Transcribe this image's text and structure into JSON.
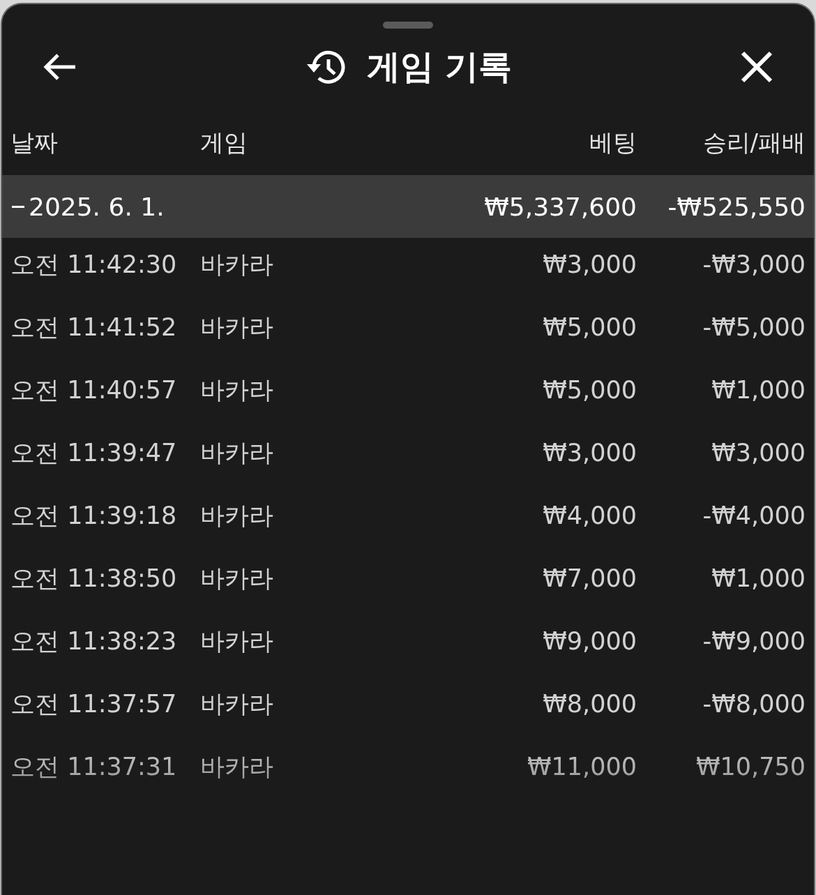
{
  "title": "게임 기록",
  "columns": [
    "날짜",
    "게임",
    "베팅",
    "승리/패배"
  ],
  "group": {
    "label": "2025. 6. 1.",
    "expanded": true,
    "bet": "₩5,337,600",
    "result": "-₩525,550"
  },
  "rows": [
    {
      "time": "오전 11:42:30",
      "game": "바카라",
      "bet": "₩3,000",
      "result": "-₩3,000"
    },
    {
      "time": "오전 11:41:52",
      "game": "바카라",
      "bet": "₩5,000",
      "result": "-₩5,000"
    },
    {
      "time": "오전 11:40:57",
      "game": "바카라",
      "bet": "₩5,000",
      "result": "₩1,000"
    },
    {
      "time": "오전 11:39:47",
      "game": "바카라",
      "bet": "₩3,000",
      "result": "₩3,000"
    },
    {
      "time": "오전 11:39:18",
      "game": "바카라",
      "bet": "₩4,000",
      "result": "-₩4,000"
    },
    {
      "time": "오전 11:38:50",
      "game": "바카라",
      "bet": "₩7,000",
      "result": "₩1,000"
    },
    {
      "time": "오전 11:38:23",
      "game": "바카라",
      "bet": "₩9,000",
      "result": "-₩9,000"
    },
    {
      "time": "오전 11:37:57",
      "game": "바카라",
      "bet": "₩8,000",
      "result": "-₩8,000"
    },
    {
      "time": "오전 11:37:31",
      "game": "바카라",
      "bet": "₩11,000",
      "result": "₩10,750"
    }
  ]
}
